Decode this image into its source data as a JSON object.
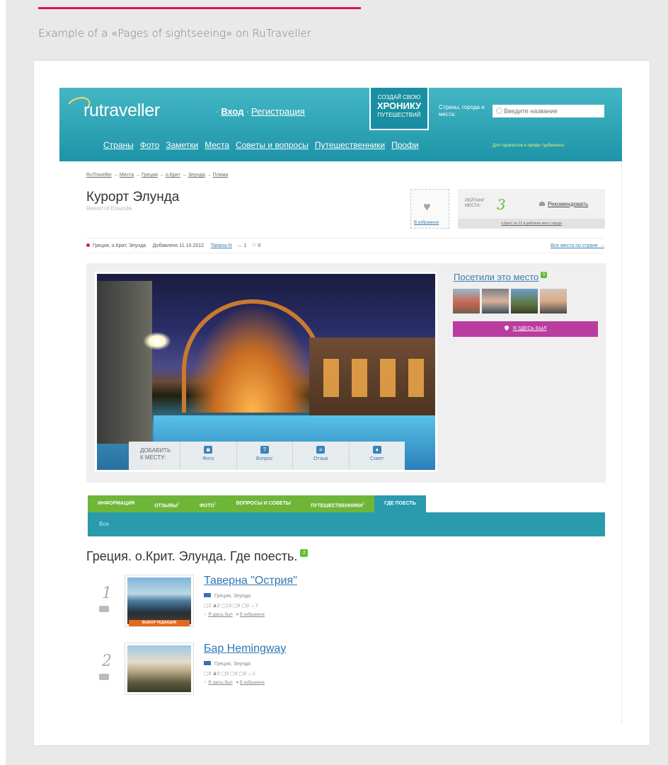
{
  "caption": "Example of a «Pages of sightseeing» on RuTraveller",
  "header": {
    "logo": "rutraveller",
    "login": "Вход",
    "register": "Регистрация",
    "chronicle_top": "СОЗДАЙ СВОЮ",
    "chronicle_mid": "ХРОНИКУ",
    "chronicle_bot": "ПУТЕШЕСТВИЙ",
    "search_label": "Страны, города и места:",
    "search_placeholder": "Введите название",
    "nav": [
      "Страны",
      "Фото",
      "Заметки",
      "Места",
      "Советы и вопросы",
      "Путешественники",
      "Профи"
    ],
    "nav_small": "Для турагентов и профи турбизнеса"
  },
  "breadcrumbs": [
    "RuTraveller",
    "Места",
    "Греция",
    "о.Крит",
    "Элунда",
    "Пляжи"
  ],
  "place": {
    "title": "Курорт Элунда",
    "subtitle": "Resort of Elounda",
    "fav_label": "В избранное",
    "rating_label": "РЕЙТИНГ МЕСТА:",
    "rating_value": "3",
    "recommend": "Рекомендовать",
    "rating_foot": "о.Крит: № 22 в рейтинге мест города"
  },
  "meta": {
    "location": "Греция, о.Крит, Элунда",
    "added": "Добавлено 11.10.2012",
    "author": "Tatiana-N",
    "shares": "↔ 1",
    "comments": "♡ 0",
    "all_places": "Все места по стране →"
  },
  "media": {
    "add_label_1": "ДОБАВИТЬ",
    "add_label_2": "К МЕСТУ:",
    "add_items": [
      "Фото",
      "Вопрос",
      "Отзыв",
      "Совет"
    ],
    "visited_title": "Посетили это место",
    "visited_count": "5",
    "was_here": "Я ЗДЕСЬ БЫЛ"
  },
  "tabs": {
    "items": [
      "ИНФОРМАЦИЯ",
      "ОТЗЫВЫ",
      "ФОТО",
      "ВОПРОСЫ И СОВЕТЫ",
      "ПУТЕШЕСТВЕННИКИ",
      "ГДЕ ПОЕСТЬ"
    ],
    "sups": [
      "",
      "0",
      "5",
      "",
      "5",
      ""
    ],
    "subtab": "Все"
  },
  "section": {
    "title": "Греция. о.Крит. Элунда. Где поесть.",
    "count": "2"
  },
  "places": [
    {
      "num": "1",
      "title": "Таверна \"Острия\"",
      "loc": "Греция, Элунда",
      "stats": "▢2  ♟2  ▢13  ▢0  ▢0  ↔7",
      "here": "Я здесь был",
      "fav": "В избранное",
      "ribbon": "ВЫБОР РЕДАКЦИИ"
    },
    {
      "num": "2",
      "title": "Бар Hemingway",
      "loc": "Греция, Элунда",
      "stats": "▢0  ♟0  ▢0  ▢0  ▢0  ↔1",
      "here": "Я здесь был",
      "fav": "В избранное",
      "ribbon": ""
    }
  ],
  "colors": {
    "accent": "#d8184b",
    "header": "#2aa3b5",
    "green": "#6fb538",
    "link": "#3a7fb3",
    "purple": "#b93c9e"
  }
}
